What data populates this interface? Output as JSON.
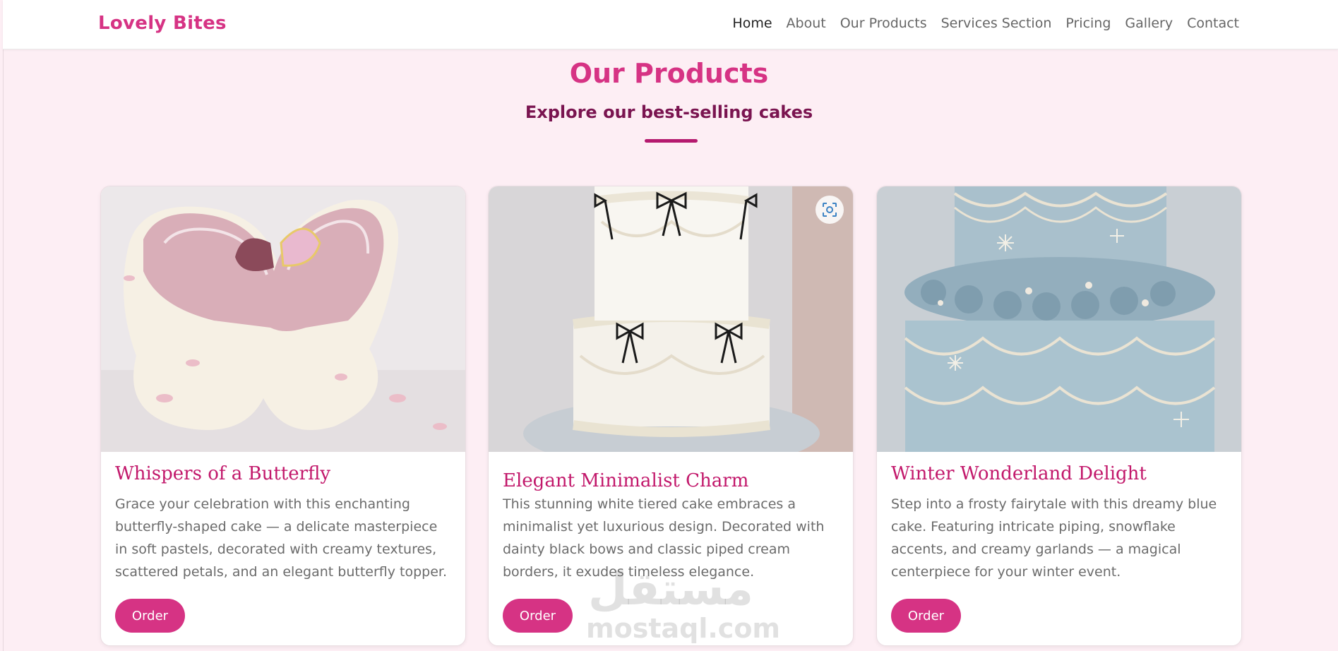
{
  "brand": "Lovely Bites",
  "nav": [
    "Home",
    "About",
    "Our Products",
    "Services Section",
    "Pricing",
    "Gallery",
    "Contact"
  ],
  "nav_active": "Home",
  "section": {
    "title": "Our Products",
    "subtitle": "Explore our best-selling cakes"
  },
  "products": [
    {
      "title": "Whispers of a Butterfly",
      "description": "Grace your celebration with this enchanting butterfly-shaped cake — a delicate masterpiece in soft pastels, decorated with creamy textures, scattered petals, and an elegant butterfly topper.",
      "button": "Order"
    },
    {
      "title": "Elegant Minimalist Charm",
      "description": "This stunning white tiered cake embraces a minimalist yet luxurious design. Decorated with dainty black bows and classic piped cream borders, it exudes timeless elegance.",
      "button": "Order"
    },
    {
      "title": "Winter Wonderland Delight",
      "description": "Step into a frosty fairytale with this dreamy blue cake. Featuring intricate piping, snowflake accents, and creamy garlands — a magical centerpiece for your winter event.",
      "button": "Order"
    }
  ],
  "watermark": {
    "arabic": "مستقل",
    "latin": "mostaql.com"
  },
  "colors": {
    "accent": "#d63384",
    "background": "#fdeef4",
    "subtitle": "#7a1450"
  },
  "icons": {
    "image_search": "lens-icon"
  }
}
